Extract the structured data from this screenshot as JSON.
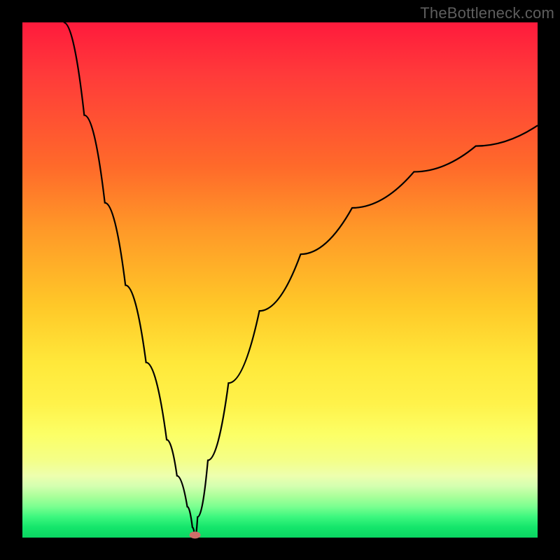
{
  "watermark": "TheBottleneck.com",
  "chart_data": {
    "type": "line",
    "title": "",
    "xlabel": "",
    "ylabel": "",
    "xlim": [
      0,
      100
    ],
    "ylim": [
      0,
      100
    ],
    "grid": false,
    "legend": false,
    "background_gradient": {
      "stops": [
        {
          "pos": 0.0,
          "color": "#ff1a3c"
        },
        {
          "pos": 0.28,
          "color": "#ff6a2a"
        },
        {
          "pos": 0.55,
          "color": "#ffc828"
        },
        {
          "pos": 0.74,
          "color": "#fff24a"
        },
        {
          "pos": 0.88,
          "color": "#edffae"
        },
        {
          "pos": 1.0,
          "color": "#0ad662"
        }
      ]
    },
    "series": [
      {
        "name": "bottleneck-curve-left",
        "x": [
          8,
          12,
          16,
          20,
          24,
          28,
          30,
          32,
          33,
          33.5
        ],
        "y": [
          100,
          82,
          65,
          49,
          34,
          19,
          12,
          6,
          2,
          0
        ]
      },
      {
        "name": "bottleneck-curve-right",
        "x": [
          33.5,
          34,
          36,
          40,
          46,
          54,
          64,
          76,
          88,
          100
        ],
        "y": [
          0,
          4,
          15,
          30,
          44,
          55,
          64,
          71,
          76,
          80
        ]
      }
    ],
    "marker": {
      "x": 33.5,
      "y": 0.5,
      "color": "#cf6f6a"
    },
    "annotations": [
      {
        "text": "TheBottleneck.com",
        "role": "watermark"
      }
    ]
  }
}
